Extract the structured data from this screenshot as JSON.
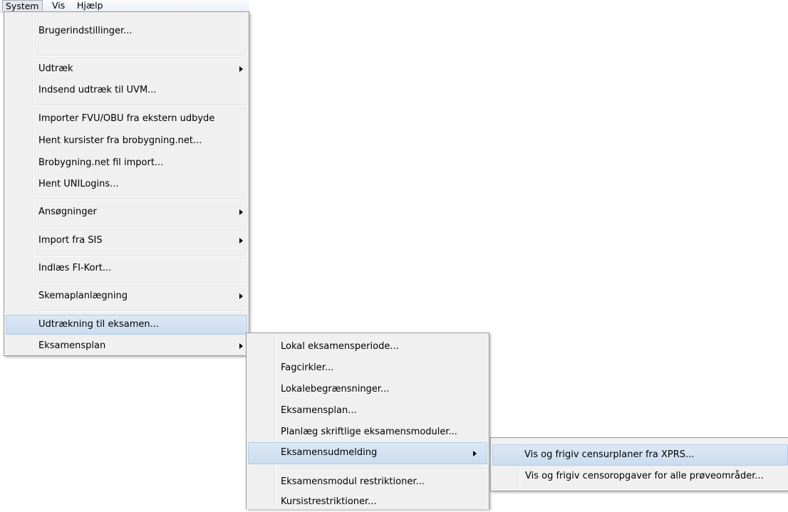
{
  "menubar": {
    "items": [
      {
        "label": "System"
      },
      {
        "label": "Vis"
      },
      {
        "label": "Hjælp"
      }
    ]
  },
  "system_menu": {
    "items": [
      {
        "label": "Brugerindstillinger..."
      },
      {
        "label": "Udtræk"
      },
      {
        "label": "Indsend udtræk til UVM..."
      },
      {
        "label": "Importer FVU/OBU fra ekstern udbyde"
      },
      {
        "label": "Hent kursister fra brobygning.net..."
      },
      {
        "label": "Brobygning.net fil import..."
      },
      {
        "label": "Hent UNILogins..."
      },
      {
        "label": "Ansøgninger"
      },
      {
        "label": "Import fra SIS"
      },
      {
        "label": "Indlæs FI-Kort..."
      },
      {
        "label": "Skemaplanlægning"
      },
      {
        "label": "Udtrækning til eksamen..."
      },
      {
        "label": "Eksamensplan"
      }
    ]
  },
  "eksamensplan_menu": {
    "items": [
      {
        "label": "Lokal eksamensperiode..."
      },
      {
        "label": "Fagcirkler..."
      },
      {
        "label": "Lokalebegrænsninger..."
      },
      {
        "label": "Eksamensplan..."
      },
      {
        "label": "Planlæg skriftlige eksamensmoduler..."
      },
      {
        "label": "Eksamensudmelding"
      },
      {
        "label": "Eksamensmodul restriktioner..."
      },
      {
        "label": "Kursistrestriktioner..."
      }
    ]
  },
  "eksamensudmelding_menu": {
    "items": [
      {
        "label": "Vis og frigiv censurplaner fra XPRS..."
      },
      {
        "label": "Vis og frigiv censoropgaver for alle prøveområder..."
      }
    ]
  }
}
